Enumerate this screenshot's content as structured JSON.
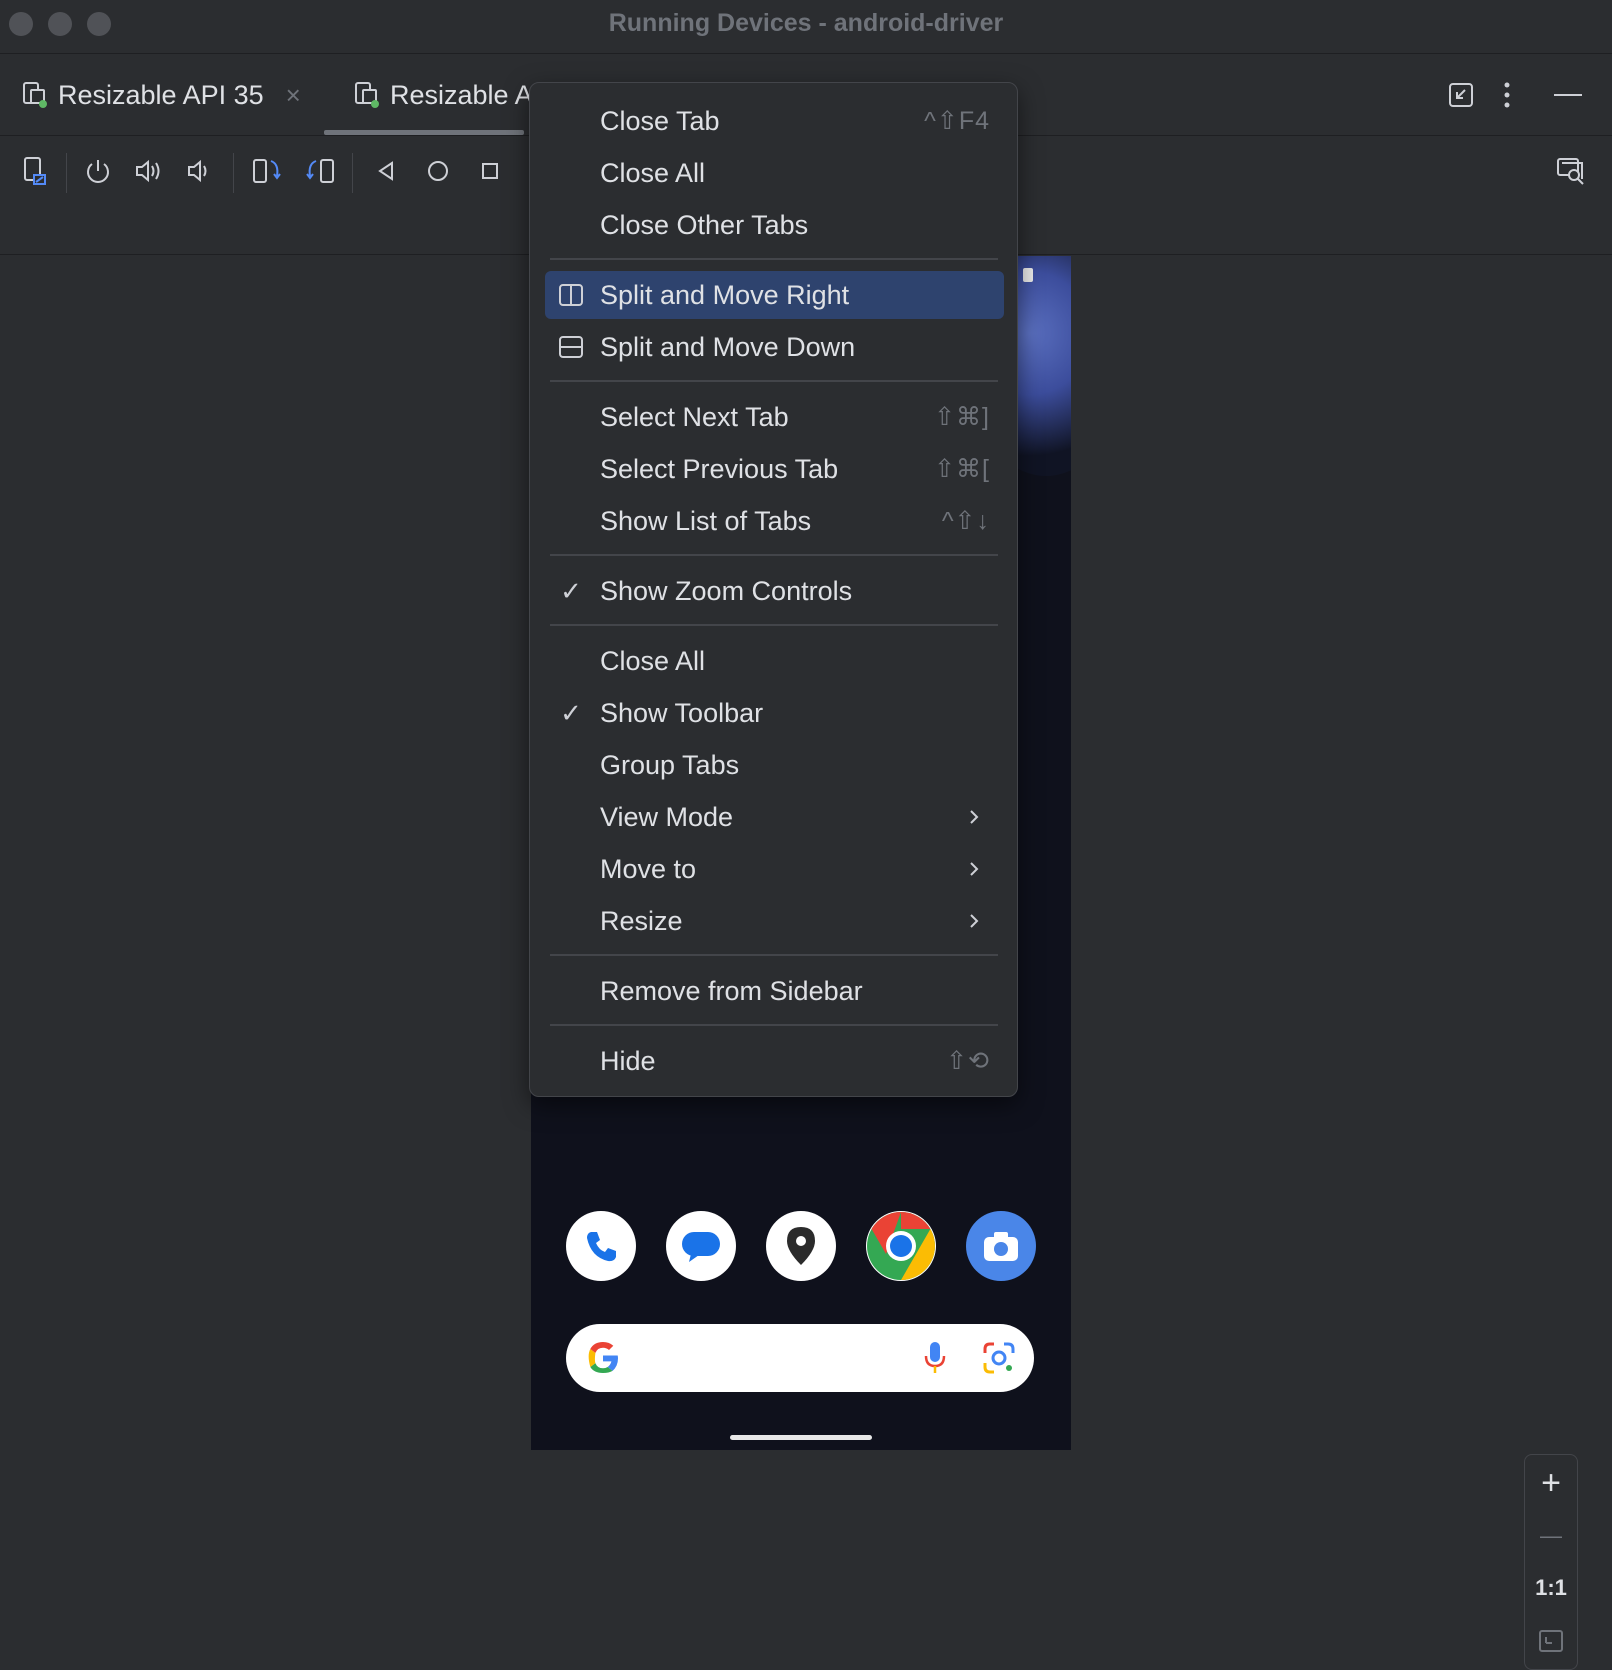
{
  "window": {
    "title": "Running Devices - android-driver"
  },
  "tabs": [
    {
      "label": "Resizable API 35",
      "close": "×"
    },
    {
      "label": "Resizable A"
    }
  ],
  "zoom": {
    "in": "+",
    "out": "—",
    "actual": "1:1"
  },
  "menu": {
    "items": [
      {
        "label": "Close Tab",
        "shortcut": "^⇧F4"
      },
      {
        "label": "Close All"
      },
      {
        "label": "Close Other Tabs"
      },
      {
        "label": "Split and Move Right",
        "icon": "split-vertical-icon",
        "selected": true
      },
      {
        "label": "Split and Move Down",
        "icon": "split-horizontal-icon"
      },
      {
        "label": "Select Next Tab",
        "shortcut": "⇧⌘]"
      },
      {
        "label": "Select Previous Tab",
        "shortcut": "⇧⌘["
      },
      {
        "label": "Show List of Tabs",
        "shortcut": "^⇧↓"
      },
      {
        "label": "Show Zoom Controls",
        "checked": true
      },
      {
        "label": "Close All"
      },
      {
        "label": "Show Toolbar",
        "checked": true
      },
      {
        "label": "Group Tabs"
      },
      {
        "label": "View Mode",
        "submenu": true
      },
      {
        "label": "Move to",
        "submenu": true
      },
      {
        "label": "Resize",
        "submenu": true
      },
      {
        "label": "Remove from Sidebar"
      },
      {
        "label": "Hide",
        "shortcut": "⇧⟲"
      }
    ]
  },
  "check_glyph": "✓",
  "colors": {
    "background": "#2b2d30",
    "selected": "#2e436e",
    "text": "#dfe1e5",
    "muted": "#6f737a",
    "accent": "#548af7"
  },
  "toolbar_icons": [
    "device-mirror-icon",
    "power-icon",
    "volume-up-icon",
    "volume-down-icon",
    "rotate-left-icon",
    "rotate-right-icon",
    "back-icon",
    "home-icon",
    "overview-icon",
    "layout-inspector-icon"
  ],
  "dock_icons": [
    "phone-app-icon",
    "messages-app-icon",
    "maps-app-icon",
    "chrome-app-icon",
    "camera-app-icon"
  ]
}
